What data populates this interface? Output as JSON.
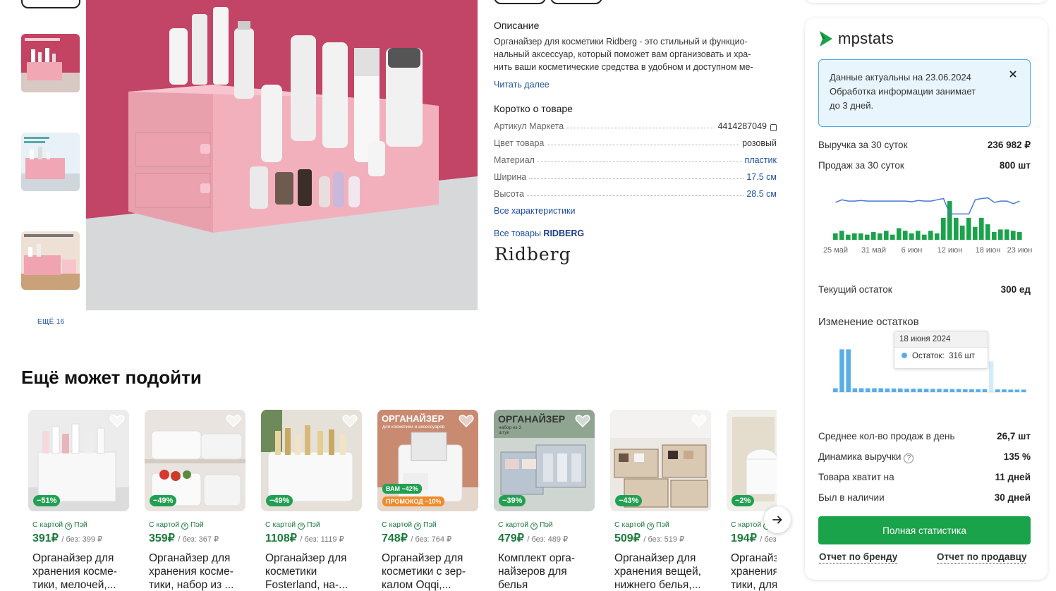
{
  "gallery": {
    "more_label": "ЕЩЁ 16"
  },
  "description": {
    "title": "Описание",
    "text": "Органайзер для косметики Ridberg - это стильный и функцио-нальный аксессуар, который поможет вам организовать и хра-нить ваши косметические средства в удобном и доступном ме-",
    "read_more": "Читать далее",
    "brief_title": "Коротко о товаре",
    "specs": [
      {
        "key": "Артикул Маркета",
        "value": "4414287049"
      },
      {
        "key": "Цвет товара",
        "value": "розовый"
      },
      {
        "key": "Материал",
        "value": "пластик"
      },
      {
        "key": "Ширина",
        "value": "17.5 см"
      },
      {
        "key": "Высота",
        "value": "28.5 см"
      }
    ],
    "all_specs": "Все характеристики",
    "all_goods_prefix": "Все товары",
    "brand_name": "RIDBERG",
    "brand_logo": "Ridberg"
  },
  "recommendations": {
    "title": "Ещё может подойти",
    "pay_label": "С картой",
    "pay_brand": "Пэй",
    "items": [
      {
        "price": "391",
        "currency": "₽",
        "old_price": "/ без: 399 ₽",
        "discount": "−51%",
        "name": "Органайзер для хранения косме-тики, мелочей,..."
      },
      {
        "price": "359",
        "currency": "₽",
        "old_price": "/ без: 367 ₽",
        "discount": "−49%",
        "name": "Органайзер для хранения косме-тики, набор из ..."
      },
      {
        "price": "1108",
        "currency": "₽",
        "old_price": "/ без: 1119 ₽",
        "discount": "−49%",
        "name": "Органайзер для косметики Fosterland, на-..."
      },
      {
        "price": "748",
        "currency": "₽",
        "old_price": "/ без: 764 ₽",
        "promo_a": "ВАМ −42%",
        "promo_b": "ПРОМОКОД −10%",
        "img_title": "ОРГАНАЙЗЕР",
        "img_sub": "для косметики и аксессуаров",
        "name": "Органайзер для косметики с зер-калом Oqqi,..."
      },
      {
        "price": "479",
        "currency": "₽",
        "old_price": "/ без: 489 ₽",
        "discount": "−39%",
        "img_title": "ОРГАНАЙЗЕР",
        "img_sub": "набор из 3 штук",
        "name": "Комплект орга-найзеров для белья"
      },
      {
        "price": "509",
        "currency": "₽",
        "old_price": "/ без: 519 ₽",
        "discount": "−43%",
        "name": "Органайзер для хранения вещей, нижнего белья,..."
      },
      {
        "price": "194",
        "currency": "₽",
        "old_price": "/ без:",
        "discount": "−2%",
        "name": "Органайзер для хранения косме-тики, для..."
      }
    ]
  },
  "mpstats": {
    "logo": "mpstats",
    "notice_line1": "Данные актуальны на 23.06.2024",
    "notice_line2": "Обработка информации занимает",
    "notice_line3": "до 3 дней.",
    "revenue_label": "Выручка за 30 суток",
    "revenue_value": "236 982 ₽",
    "sales_label": "Продаж за 30 суток",
    "sales_value": "800 шт",
    "stock_label": "Текущий остаток",
    "stock_value": "300 ед",
    "stock_change_title": "Изменение остатков",
    "tooltip_date": "18 июня 2024",
    "tooltip_label": "Остаток:",
    "tooltip_value": "316 шт",
    "avg_sales_label": "Среднее кол-во продаж в день",
    "avg_sales_value": "26,7 шт",
    "revenue_dynamics_label": "Динамика выручки",
    "revenue_dynamics_value": "135 %",
    "enough_label": "Товара хватит на",
    "enough_value": "11 дней",
    "available_label": "Был в наличии",
    "available_value": "30 дней",
    "full_stats_button": "Полная статистика",
    "brand_report": "Отчет по бренду",
    "seller_report": "Отчет по продавцу",
    "colors": {
      "accent": "#1aa34a",
      "line": "#4a78d8",
      "stock_bar": "#5aaee8"
    }
  },
  "chart_data": [
    {
      "type": "bar",
      "title": "",
      "categories": [
        "25 май",
        "26 май",
        "27 май",
        "28 май",
        "29 май",
        "30 май",
        "31 май",
        "1 июн",
        "2 июн",
        "3 июн",
        "4 июн",
        "5 июн",
        "6 июн",
        "7 июн",
        "8 июн",
        "9 июн",
        "10 июн",
        "11 июн",
        "12 июн",
        "13 июн",
        "14 июн",
        "15 июн",
        "16 июн",
        "17 июн",
        "18 июн",
        "19 июн",
        "20 июн",
        "21 июн",
        "22 июн",
        "23 июн"
      ],
      "tick_labels": [
        "25 май",
        "31 май",
        "6 июн",
        "12 июн",
        "18 июн",
        "23 июн"
      ],
      "series": [
        {
          "values": [
            10,
            14,
            8,
            10,
            10,
            8,
            12,
            10,
            14,
            8,
            18,
            14,
            10,
            14,
            8,
            14,
            10,
            34,
            60,
            34,
            22,
            34,
            20,
            34,
            24,
            12,
            16,
            16,
            14,
            12
          ]
        },
        {
          "values": [
            58,
            62,
            60,
            60,
            61,
            60,
            60,
            60,
            60,
            60,
            60,
            60,
            59,
            61,
            60,
            60,
            62,
            64,
            40,
            40,
            40,
            40,
            62,
            64,
            65,
            58,
            60,
            60,
            56,
            60
          ]
        }
      ]
    },
    {
      "type": "bar",
      "title": "",
      "categories": [
        "25 май",
        "26 май",
        "27 май",
        "28 май",
        "29 май",
        "30 май",
        "31 май",
        "1 июн",
        "2 июн",
        "3 июн",
        "4 июн",
        "5 июн",
        "6 июн",
        "7 июн",
        "8 июн",
        "9 июн",
        "10 июн",
        "11 июн",
        "12 июн",
        "13 июн",
        "14 июн",
        "15 июн",
        "16 июн",
        "17 июн",
        "18 июн",
        "19 июн",
        "20 июн",
        "21 июн",
        "22 июн",
        "23 июн"
      ],
      "tick_labels": [
        "25 май",
        "31 май",
        "6 июн",
        "12 июн",
        "18 июн",
        "23 июн"
      ],
      "series": [
        {
          "values": [
            40,
            440,
            440,
            40,
            40,
            40,
            40,
            40,
            38,
            38,
            38,
            36,
            36,
            36,
            34,
            34,
            34,
            32,
            32,
            32,
            30,
            30,
            30,
            30,
            316,
            28,
            28,
            26,
            26,
            26
          ]
        }
      ]
    }
  ]
}
